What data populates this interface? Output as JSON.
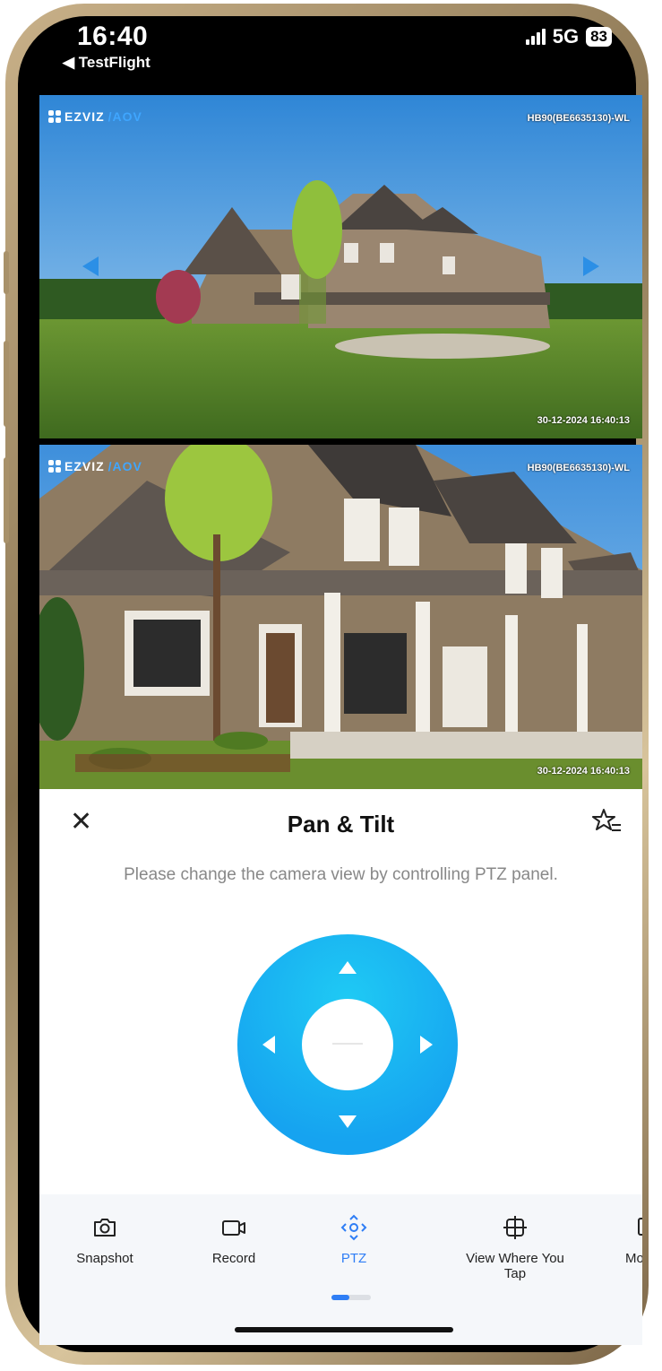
{
  "status_bar": {
    "time": "16:40",
    "back_app": "◀ TestFlight",
    "network": "5G",
    "battery": "83"
  },
  "cameras": [
    {
      "brand_prefix": "EZVIZ",
      "brand_suffix": "/AOV",
      "device_id": "HB90(BE6635130)-WL",
      "timestamp": "30-12-2024 16:40:13"
    },
    {
      "brand_prefix": "EZVIZ",
      "brand_suffix": "/AOV",
      "device_id": "HB90(BE6635130)-WL",
      "timestamp": "30-12-2024 16:40:13"
    }
  ],
  "sheet": {
    "title": "Pan & Tilt",
    "hint": "Please change the camera view by controlling PTZ panel."
  },
  "toolbar": [
    {
      "label": "Snapshot",
      "icon": "camera-icon"
    },
    {
      "label": "Record",
      "icon": "video-record-icon"
    },
    {
      "label": "PTZ",
      "icon": "ptz-icon",
      "active": true
    },
    {
      "label": "View Where You Tap",
      "icon": "crosshair-icon"
    },
    {
      "label": "Mon",
      "icon": "monitor-icon"
    }
  ],
  "colors": {
    "accent": "#2f7ef5",
    "ptz_blue": "#16a3f0",
    "sky": "#4aa3e6",
    "grass": "#5f8a2b"
  }
}
